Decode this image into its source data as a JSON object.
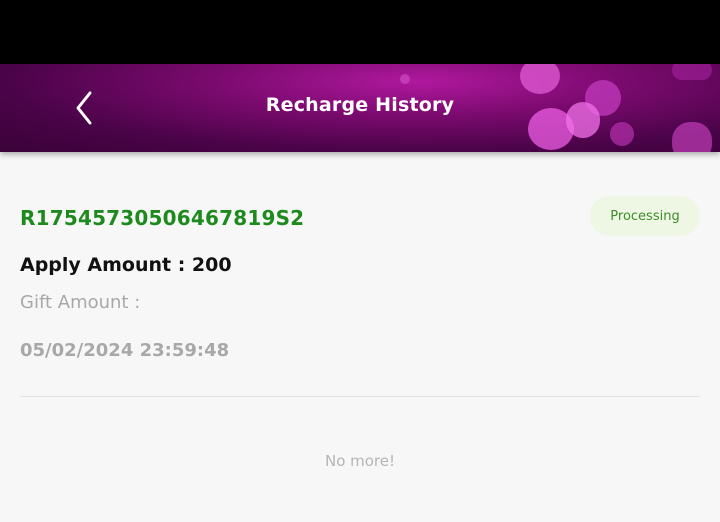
{
  "header": {
    "title": "Recharge History",
    "back_icon": "chevron-left-icon",
    "accent_color": "#8a0f7e"
  },
  "records": [
    {
      "order_id": "R17545730506467819S2",
      "status": "Processing",
      "status_color": "#3f8a2a",
      "apply_amount": "Apply Amount : 200",
      "gift_amount": "Gift Amount :",
      "datetime": "05/02/2024 23:59:48"
    }
  ],
  "footer": {
    "no_more": "No more!"
  }
}
